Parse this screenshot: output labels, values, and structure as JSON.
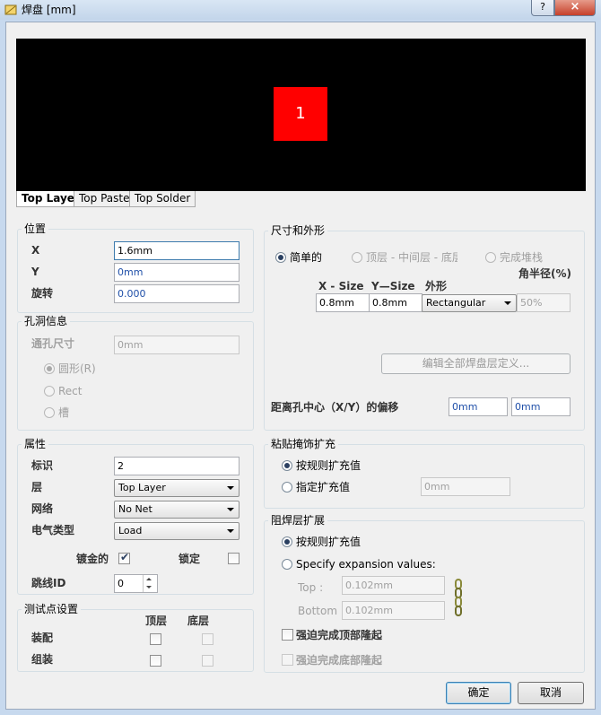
{
  "window": {
    "title": "焊盘 [mm]",
    "help": "?",
    "close": "×"
  },
  "preview": {
    "pad_label": "1",
    "pad_color": "#ff0000",
    "background": "#000000"
  },
  "layer_tabs": [
    {
      "label": "Top Layer",
      "active": true
    },
    {
      "label": "Top Paste",
      "active": false
    },
    {
      "label": "Top Solder",
      "active": false
    }
  ],
  "location": {
    "title": "位置",
    "x_label": "X",
    "x_value": "1.6mm",
    "y_label": "Y",
    "y_value": "0mm",
    "rotation_label": "旋转",
    "rotation_value": "0.000"
  },
  "hole": {
    "title": "孔洞信息",
    "size_label": "通孔尺寸",
    "size_value": "0mm",
    "round": "圆形(R)",
    "rect": "Rect",
    "slot": "槽"
  },
  "properties": {
    "title": "属性",
    "designator_label": "标识",
    "designator_value": "2",
    "layer_label": "层",
    "layer_value": "Top Layer",
    "net_label": "网络",
    "net_value": "No Net",
    "type_label": "电气类型",
    "type_value": "Load",
    "plated_label": "镀金的",
    "locked_label": "锁定",
    "jumper_label": "跳线ID",
    "jumper_value": "0"
  },
  "testpoint": {
    "title": "测试点设置",
    "top_col": "顶层",
    "bottom_col": "底层",
    "fab_label": "装配",
    "assy_label": "组装"
  },
  "size_shape": {
    "title": "尺寸和外形",
    "simple": "简单的",
    "top_mid_bottom": "顶层 - 中间层 - 底层",
    "full_stack": "完成堆栈",
    "corner_label": "角半径(%)",
    "xsize_label": "X - Size",
    "ysize_label": "Y—Size",
    "shape_label": "外形",
    "xsize_value": "0.8mm",
    "ysize_value": "0.8mm",
    "shape_value": "Rectangular",
    "corner_value": "50%",
    "edit_button": "编辑全部焊盘层定义...",
    "offset_label": "距离孔中心（X/Y）的偏移",
    "offset_x": "0mm",
    "offset_y": "0mm"
  },
  "paste_mask": {
    "title": "粘贴掩饰扩充",
    "rule": "按规则扩充值",
    "specify": "指定扩充值",
    "value": "0mm"
  },
  "solder_mask": {
    "title": "阻焊层扩展",
    "rule": "按规则扩充值",
    "specify": "Specify expansion values:",
    "top_label": "Top :",
    "top_value": "0.102mm",
    "bottom_label": "Bottom :",
    "bottom_value": "0.102mm",
    "force_top": "强迫完成顶部隆起",
    "force_bottom": "强迫完成底部隆起"
  },
  "footer": {
    "ok": "确定",
    "cancel": "取消"
  },
  "icons": {
    "title": "pad-icon",
    "link": "chain-link-icon"
  }
}
